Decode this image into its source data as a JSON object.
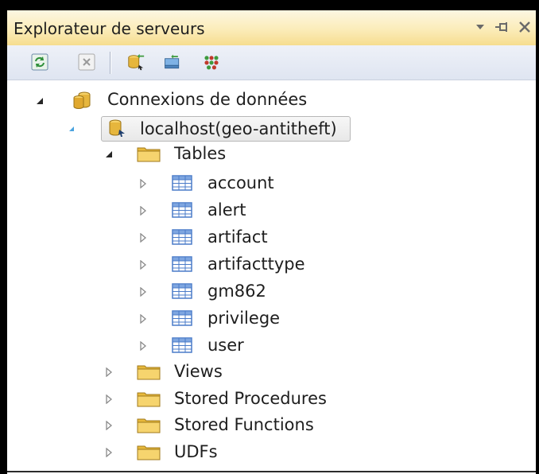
{
  "panel": {
    "title": "Explorateur de serveurs",
    "controls": [
      "dropdown-arrow",
      "pin",
      "close"
    ],
    "controls_glyphs": {
      "dropdown": "▾",
      "pin": "⫤",
      "close": "✕"
    }
  },
  "toolbar": {
    "buttons": [
      {
        "name": "refresh-icon"
      },
      {
        "name": "stop-icon"
      },
      {
        "name": "connect-to-database-icon"
      },
      {
        "name": "connect-to-server-icon"
      },
      {
        "name": "sharepoint-connection-icon"
      }
    ]
  },
  "tree": {
    "root": {
      "label": "Connexions de données",
      "expanded": true
    },
    "connection": {
      "label": "localhost(geo-antitheft)",
      "expanded": true,
      "selected": true
    },
    "tables_folder": {
      "label": "Tables",
      "expanded": true
    },
    "tables": [
      {
        "label": "account"
      },
      {
        "label": "alert"
      },
      {
        "label": "artifact"
      },
      {
        "label": "artifacttype"
      },
      {
        "label": "gm862"
      },
      {
        "label": "privilege"
      },
      {
        "label": "user"
      }
    ],
    "folders": [
      {
        "label": "Views"
      },
      {
        "label": "Stored Procedures"
      },
      {
        "label": "Stored Functions"
      },
      {
        "label": "UDFs"
      }
    ]
  },
  "colors": {
    "title_bg": "#fbecb9",
    "toolbar_bg": "#e6eaf4",
    "folder": "#f2c94c",
    "table_grid": "#4a7bc8",
    "database": "#e0a82e"
  }
}
